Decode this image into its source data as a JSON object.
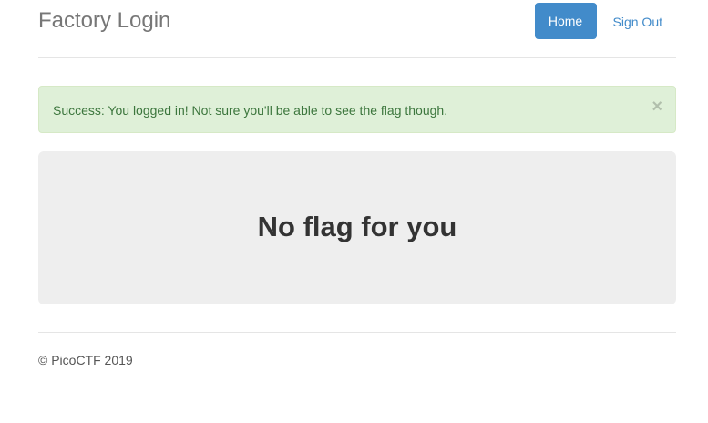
{
  "header": {
    "brand": "Factory Login",
    "nav": {
      "home_label": "Home",
      "signout_label": "Sign Out"
    }
  },
  "alert": {
    "message": "Success: You logged in! Not sure you'll be able to see the flag though.",
    "close_glyph": "×"
  },
  "main": {
    "heading": "No flag for you"
  },
  "footer": {
    "copyright": "© PicoCTF 2019"
  },
  "colors": {
    "primary": "#428bca",
    "success_bg": "#dff0d8",
    "success_text": "#3c763d",
    "jumbotron_bg": "#eeeeee"
  }
}
